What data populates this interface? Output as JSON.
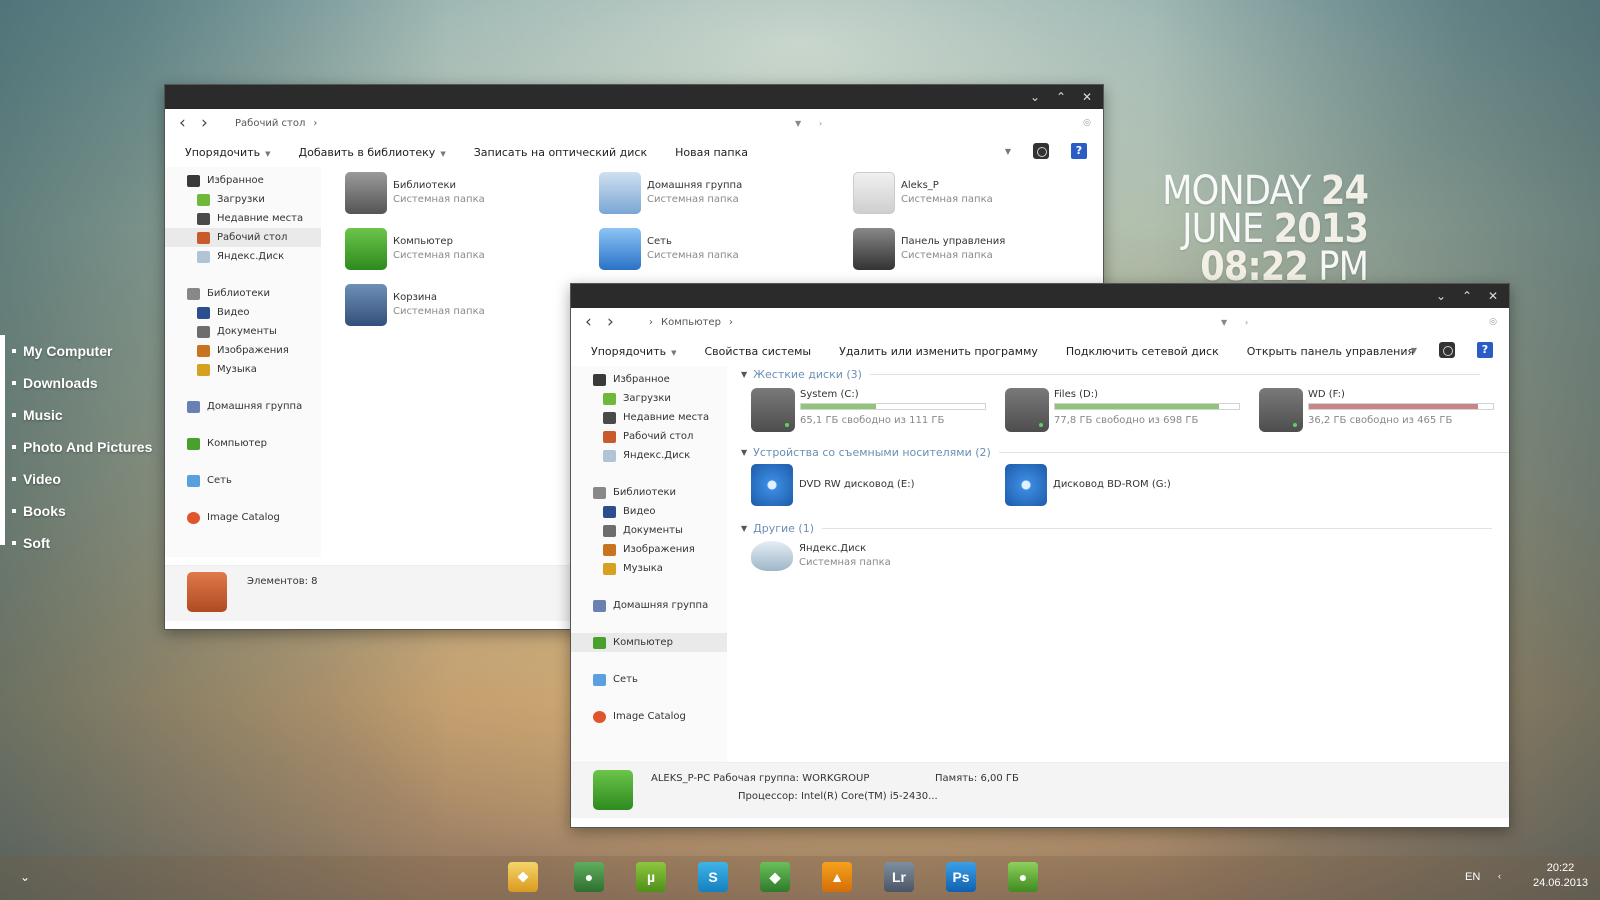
{
  "leftdock": {
    "items": [
      {
        "label": "My Computer"
      },
      {
        "label": "Downloads"
      },
      {
        "label": "Music"
      },
      {
        "label": "Photo And Pictures"
      },
      {
        "label": "Video"
      },
      {
        "label": "Books"
      },
      {
        "label": "Soft"
      }
    ]
  },
  "clock": {
    "day": "MONDAY",
    "date": "24",
    "month": "JUNE",
    "year": "2013",
    "time": "08:22",
    "ampm": "PM"
  },
  "win1": {
    "address": {
      "crumb": "Рабочий стол"
    },
    "toolbar": {
      "organize": "Упорядочить",
      "add_library": "Добавить в библиотеку",
      "burn": "Записать на оптический диск",
      "new_folder": "Новая папка"
    },
    "sidebar": {
      "favorites": "Избранное",
      "downloads": "Загрузки",
      "recent": "Недавние места",
      "desktop": "Рабочий стол",
      "yandex": "Яндекс.Диск",
      "libraries": "Библиотеки",
      "video": "Видео",
      "documents": "Документы",
      "images": "Изображения",
      "music": "Музыка",
      "homegroup": "Домашняя группа",
      "computer": "Компьютер",
      "network": "Сеть",
      "catalog": "Image Catalog"
    },
    "items": [
      {
        "name": "Библиотеки",
        "sub": "Системная папка"
      },
      {
        "name": "Домашняя группа",
        "sub": "Системная папка"
      },
      {
        "name": "Aleks_P",
        "sub": "Системная папка"
      },
      {
        "name": "Компьютер",
        "sub": "Системная папка"
      },
      {
        "name": "Сеть",
        "sub": "Системная папка"
      },
      {
        "name": "Панель управления",
        "sub": "Системная папка"
      },
      {
        "name": "Корзина",
        "sub": "Системная папка"
      }
    ],
    "status": "Элементов: 8"
  },
  "win2": {
    "address": {
      "crumb": "Компьютер"
    },
    "toolbar": {
      "organize": "Упорядочить",
      "sysprops": "Свойства системы",
      "uninstall": "Удалить или изменить программу",
      "mapdrive": "Подключить сетевой диск",
      "controlpanel": "Открыть панель управления"
    },
    "sidebar": {
      "favorites": "Избранное",
      "downloads": "Загрузки",
      "recent": "Недавние места",
      "desktop": "Рабочий стол",
      "yandex": "Яндекс.Диск",
      "libraries": "Библиотеки",
      "video": "Видео",
      "documents": "Документы",
      "images": "Изображения",
      "music": "Музыка",
      "homegroup": "Домашняя группа",
      "computer": "Компьютер",
      "network": "Сеть",
      "catalog": "Image Catalog"
    },
    "groups": {
      "hdd": "Жесткие диски (3)",
      "removable": "Устройства со съемными носителями (2)",
      "other": "Другие (1)"
    },
    "drives": [
      {
        "name": "System (C:)",
        "free": "65,1 ГБ свободно из 111 ГБ",
        "used_fraction": 0.41,
        "color": "#8fc47a"
      },
      {
        "name": "Files (D:)",
        "free": "77,8 ГБ свободно из 698 ГБ",
        "used_fraction": 0.89,
        "color": "#8fc47a"
      },
      {
        "name": "WD (F:)",
        "free": "36,2 ГБ свободно из 465 ГБ",
        "used_fraction": 0.92,
        "color": "#c98686"
      }
    ],
    "removable": [
      {
        "name": "DVD RW дисковод (E:)"
      },
      {
        "name": "Дисковод BD-ROM (G:)"
      }
    ],
    "other": [
      {
        "name": "Яндекс.Диск",
        "sub": "Системная папка"
      }
    ],
    "status": {
      "pcname": "ALEKS_P-PC",
      "workgroup": "Рабочая группа: WORKGROUP",
      "memory": "Память: 6,00 ГБ",
      "cpu": "Процессор: Intel(R) Core(TM) i5-2430..."
    }
  },
  "taskbar": {
    "lang": "EN",
    "time": "20:22",
    "date": "24.06.2013",
    "apps": [
      {
        "icon": "windows-start-icon",
        "label": ""
      },
      {
        "icon": "chrome-icon",
        "label": ""
      },
      {
        "icon": "utorrent-icon",
        "label": "µ"
      },
      {
        "icon": "skype-icon",
        "label": "S"
      },
      {
        "icon": "shield-app-icon",
        "label": ""
      },
      {
        "icon": "vlc-icon",
        "label": ""
      },
      {
        "icon": "lightroom-icon",
        "label": "Lr"
      },
      {
        "icon": "photoshop-icon",
        "label": "Ps"
      },
      {
        "icon": "evernote-icon",
        "label": ""
      }
    ]
  }
}
